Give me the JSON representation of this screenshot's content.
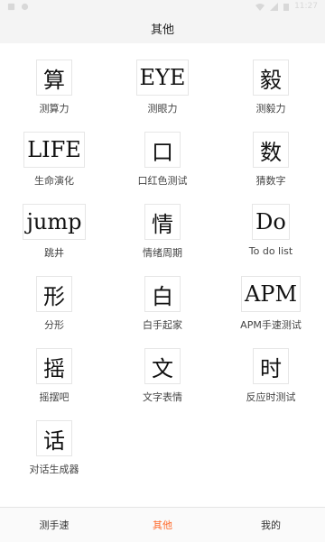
{
  "statusbar": {
    "left_icons": [
      "notification-icon",
      "debug-icon"
    ],
    "right_icons": [
      "wifi-icon",
      "signal-icon",
      "battery-icon"
    ],
    "time": "11:27"
  },
  "header": {
    "title": "其他"
  },
  "tiles": [
    {
      "glyph": "算",
      "label": "测算力"
    },
    {
      "glyph": "EYE",
      "label": "测眼力"
    },
    {
      "glyph": "毅",
      "label": "测毅力"
    },
    {
      "glyph": "LIFE",
      "label": "生命演化"
    },
    {
      "glyph": "口",
      "label": "口红色测试"
    },
    {
      "glyph": "数",
      "label": "猜数字"
    },
    {
      "glyph": "jump",
      "label": "跳井"
    },
    {
      "glyph": "情",
      "label": "情绪周期"
    },
    {
      "glyph": "Do",
      "label": "To do list"
    },
    {
      "glyph": "形",
      "label": "分形"
    },
    {
      "glyph": "白",
      "label": "白手起家"
    },
    {
      "glyph": "APM",
      "label": "APM手速测试"
    },
    {
      "glyph": "摇",
      "label": "摇摆吧"
    },
    {
      "glyph": "文",
      "label": "文字表情"
    },
    {
      "glyph": "时",
      "label": "反应时测试"
    },
    {
      "glyph": "话",
      "label": "对话生成器"
    }
  ],
  "bottom_nav": [
    {
      "label": "测手速",
      "active": false
    },
    {
      "label": "其他",
      "active": true
    },
    {
      "label": "我的",
      "active": false
    }
  ],
  "colors": {
    "accent": "#ff6a2b",
    "header_bg": "#f4f4f4"
  }
}
